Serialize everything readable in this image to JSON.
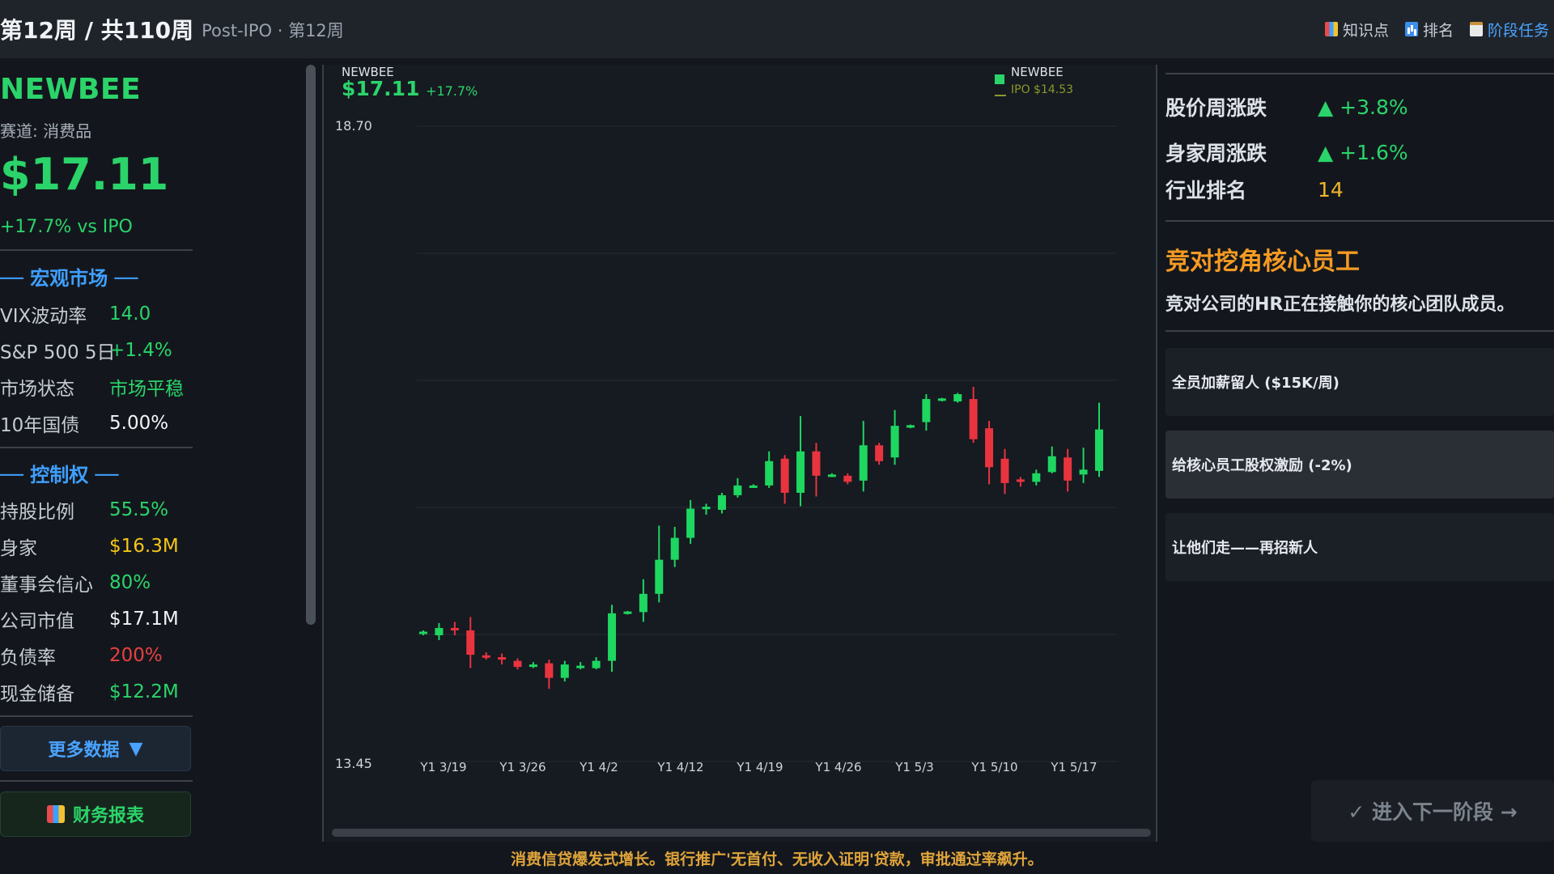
{
  "header": {
    "week_title": "第12周 / 共110周",
    "week_sub": "Post-IPO · 第12周",
    "buttons": [
      {
        "label": "知识点",
        "icon": "book-icon"
      },
      {
        "label": "排名",
        "icon": "ranking-chart-icon"
      },
      {
        "label": "阶段任务",
        "icon": "clipboard-icon"
      }
    ]
  },
  "company": {
    "name": "NEWBEE",
    "track": "赛道: 消费品",
    "price": "$17.11",
    "change": "+17.7% vs IPO"
  },
  "macro": {
    "title": "── 宏观市场 ──",
    "rows": [
      {
        "label": "VIX波动率",
        "value": "14.0",
        "color": "#2bd46a"
      },
      {
        "label": "S&P 500 5日",
        "value": "+1.4%",
        "color": "#2bd46a"
      },
      {
        "label": "市场状态",
        "value": "市场平稳",
        "color": "#2bd46a"
      },
      {
        "label": "10年国债",
        "value": "5.00%",
        "color": "#f2f4f7"
      }
    ]
  },
  "control": {
    "title": "── 控制权 ──",
    "rows": [
      {
        "label": "持股比例",
        "value": "55.5%",
        "color": "#2bd46a"
      },
      {
        "label": "身家",
        "value": "$16.3M",
        "color": "#f5c518"
      },
      {
        "label": "董事会信心",
        "value": "80%",
        "color": "#2bd46a"
      },
      {
        "label": "公司市值",
        "value": "$17.1M",
        "color": "#f2f4f7"
      },
      {
        "label": "负债率",
        "value": "200%",
        "color": "#e84040"
      },
      {
        "label": "现金储备",
        "value": "$12.2M",
        "color": "#2bd46a"
      }
    ]
  },
  "buttons": {
    "more_data": "更多数据",
    "more_data_arrow": "▼",
    "financials": "财务报表"
  },
  "chart_data": {
    "type": "candlestick",
    "ticker": "NEWBEE",
    "price": "$17.11",
    "change": "+17.7%",
    "legend": [
      {
        "name": "NEWBEE",
        "color": "#2bd46a"
      },
      {
        "name": "IPO $14.53",
        "color": "#8a9a2a"
      }
    ],
    "y_top_label": "18.70",
    "y_bottom_label": "13.45",
    "ylim": [
      13.45,
      18.7
    ],
    "x_tick_labels": [
      "Y1 3/19",
      "Y1 3/26",
      "Y1 4/2",
      "Y1 4/12",
      "Y1 4/19",
      "Y1 4/26",
      "Y1 5/3",
      "Y1 5/10",
      "Y1 5/17"
    ],
    "grid": true,
    "colors": {
      "up": "#1ed760",
      "down": "#e8343f"
    },
    "candles": [
      {
        "o": 14.54,
        "c": 14.54,
        "h": 14.56,
        "l": 14.52
      },
      {
        "o": 14.52,
        "c": 14.58,
        "h": 14.62,
        "l": 14.48
      },
      {
        "o": 14.58,
        "c": 14.56,
        "h": 14.63,
        "l": 14.52
      },
      {
        "o": 14.56,
        "c": 14.36,
        "h": 14.67,
        "l": 14.25
      },
      {
        "o": 14.35,
        "c": 14.34,
        "h": 14.38,
        "l": 14.32
      },
      {
        "o": 14.34,
        "c": 14.32,
        "h": 14.37,
        "l": 14.28
      },
      {
        "o": 14.31,
        "c": 14.26,
        "h": 14.33,
        "l": 14.24
      },
      {
        "o": 14.26,
        "c": 14.28,
        "h": 14.3,
        "l": 14.25
      },
      {
        "o": 14.29,
        "c": 14.17,
        "h": 14.32,
        "l": 14.08
      },
      {
        "o": 14.17,
        "c": 14.28,
        "h": 14.31,
        "l": 14.14
      },
      {
        "o": 14.26,
        "c": 14.26,
        "h": 14.3,
        "l": 14.24
      },
      {
        "o": 14.25,
        "c": 14.31,
        "h": 14.34,
        "l": 14.24
      },
      {
        "o": 14.31,
        "c": 14.7,
        "h": 14.77,
        "l": 14.22
      },
      {
        "o": 14.7,
        "c": 14.71,
        "h": 14.72,
        "l": 14.69
      },
      {
        "o": 14.71,
        "c": 14.86,
        "h": 14.98,
        "l": 14.63
      },
      {
        "o": 14.86,
        "c": 15.14,
        "h": 15.42,
        "l": 14.79
      },
      {
        "o": 15.14,
        "c": 15.32,
        "h": 15.41,
        "l": 15.08
      },
      {
        "o": 15.32,
        "c": 15.56,
        "h": 15.63,
        "l": 15.27
      },
      {
        "o": 15.56,
        "c": 15.57,
        "h": 15.6,
        "l": 15.51
      },
      {
        "o": 15.55,
        "c": 15.67,
        "h": 15.69,
        "l": 15.52
      },
      {
        "o": 15.67,
        "c": 15.75,
        "h": 15.81,
        "l": 15.65
      },
      {
        "o": 15.74,
        "c": 15.74,
        "h": 15.76,
        "l": 15.73
      },
      {
        "o": 15.75,
        "c": 15.95,
        "h": 16.03,
        "l": 15.73
      },
      {
        "o": 15.97,
        "c": 15.69,
        "h": 16.0,
        "l": 15.6
      },
      {
        "o": 15.69,
        "c": 16.03,
        "h": 16.32,
        "l": 15.58
      },
      {
        "o": 16.03,
        "c": 15.83,
        "h": 16.1,
        "l": 15.66
      },
      {
        "o": 15.83,
        "c": 15.83,
        "h": 15.85,
        "l": 15.82
      },
      {
        "o": 15.83,
        "c": 15.78,
        "h": 15.85,
        "l": 15.76
      },
      {
        "o": 15.79,
        "c": 16.08,
        "h": 16.28,
        "l": 15.7
      },
      {
        "o": 16.08,
        "c": 15.95,
        "h": 16.1,
        "l": 15.92
      },
      {
        "o": 15.98,
        "c": 16.24,
        "h": 16.37,
        "l": 15.92
      },
      {
        "o": 16.23,
        "c": 16.24,
        "h": 16.25,
        "l": 16.22
      },
      {
        "o": 16.27,
        "c": 16.46,
        "h": 16.5,
        "l": 16.2
      },
      {
        "o": 16.45,
        "c": 16.46,
        "h": 16.47,
        "l": 16.44
      },
      {
        "o": 16.44,
        "c": 16.5,
        "h": 16.51,
        "l": 16.43
      },
      {
        "o": 16.46,
        "c": 16.13,
        "h": 16.56,
        "l": 16.1
      },
      {
        "o": 16.22,
        "c": 15.9,
        "h": 16.28,
        "l": 15.76
      },
      {
        "o": 15.97,
        "c": 15.77,
        "h": 16.05,
        "l": 15.68
      },
      {
        "o": 15.8,
        "c": 15.78,
        "h": 15.82,
        "l": 15.74
      },
      {
        "o": 15.78,
        "c": 15.85,
        "h": 15.88,
        "l": 15.75
      },
      {
        "o": 15.86,
        "c": 15.99,
        "h": 16.07,
        "l": 15.85
      },
      {
        "o": 15.98,
        "c": 15.79,
        "h": 16.05,
        "l": 15.7
      },
      {
        "o": 15.84,
        "c": 15.88,
        "h": 16.06,
        "l": 15.77
      },
      {
        "o": 15.87,
        "c": 16.21,
        "h": 16.43,
        "l": 15.82
      }
    ]
  },
  "right": {
    "stats": [
      {
        "label": "股价周涨跌",
        "value": "▲ +3.8%",
        "color": "#2bd46a"
      },
      {
        "label": "身家周涨跌",
        "value": "▲ +1.6%",
        "color": "#2bd46a"
      },
      {
        "label": "行业排名",
        "value": "14",
        "color": "#f0b429"
      }
    ],
    "event_title": "竞对挖角核心员工",
    "event_desc": "竞对公司的HR正在接触你的核心团队成员。",
    "options": [
      "全员加薪留人 ($15K/周)",
      "给核心员工股权激励 (-2%)",
      "让他们走——再招新人"
    ],
    "next_button": "✓ 进入下一阶段 →"
  },
  "ticker": {
    "text": "消费信贷爆发式增长。银行推广'无首付、无收入证明'贷款，审批通过率飙升。"
  }
}
